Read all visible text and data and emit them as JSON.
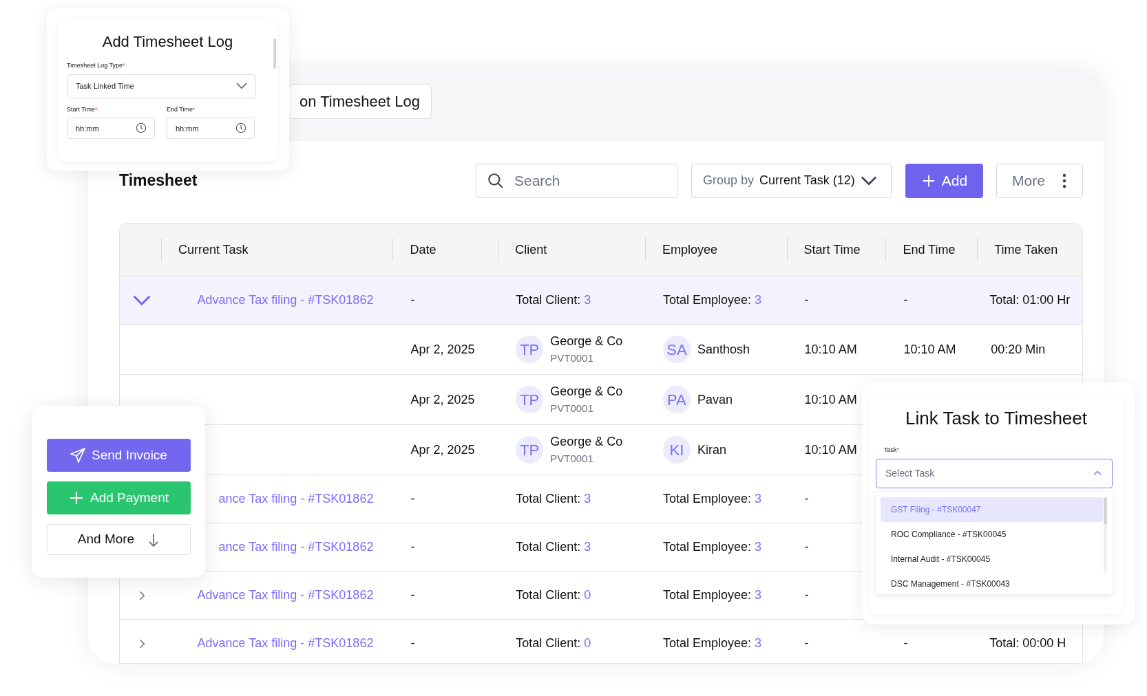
{
  "add_log_dialog": {
    "title": "Add Timesheet Log",
    "fields": [
      {
        "kind": "select",
        "label": "Timesheet Log Type",
        "mark": "*",
        "value": "Task Linked Time"
      },
      {
        "kind": "time",
        "label": "Start Time",
        "mark": "*",
        "placeholder": "hh:mm"
      },
      {
        "kind": "time",
        "label": "End Time",
        "mark": "*",
        "placeholder": "hh:mm"
      }
    ]
  },
  "main": {
    "tab": "on Timesheet Log",
    "title": "Timesheet",
    "search": {
      "placeholder": "Search"
    },
    "group_by": {
      "label": "Group by",
      "value": "Current Task (12)"
    },
    "add_button": "Add",
    "more_button": "More",
    "table": {
      "columns": [
        "Current Task",
        "Date",
        "Client",
        "Employee",
        "Start Time",
        "End Time",
        "Time Taken"
      ],
      "rows": [
        {
          "kind": "group",
          "expanded": true,
          "task": "Advance Tax filing - #TSK01862",
          "date": "-",
          "client_label": "Total Client:",
          "client_count": "3",
          "employee_label": "Total Employee:",
          "employee_count": "3",
          "start": "-",
          "end": "-",
          "time_taken": "Total: 01:00 Hr"
        },
        {
          "kind": "entry",
          "date": "Apr 2, 2025",
          "client_initials": "TP",
          "client_name": "George & Co",
          "client_code": "PVT0001",
          "employee_initials": "SA",
          "employee_name": "Santhosh",
          "start": "10:10 AM",
          "end": "10:10 AM",
          "time_taken": "00:20 Min"
        },
        {
          "kind": "entry",
          "date": "Apr 2, 2025",
          "client_initials": "TP",
          "client_name": "George & Co",
          "client_code": "PVT0001",
          "employee_initials": "PA",
          "employee_name": "Pavan",
          "start": "10:10 AM"
        },
        {
          "kind": "entry",
          "date": "Apr 2, 2025",
          "client_initials": "TP",
          "client_name": "George & Co",
          "client_code": "PVT0001",
          "employee_initials": "KI",
          "employee_name": "Kiran",
          "start": "10:10 AM"
        },
        {
          "kind": "group",
          "task": "ance Tax filing - #TSK01862",
          "date": "-",
          "client_label": "Total Client:",
          "client_count": "3",
          "employee_label": "Total Employee:",
          "employee_count": "3",
          "start": "-"
        },
        {
          "kind": "group",
          "task": "ance Tax filing - #TSK01862",
          "date": "-",
          "client_label": "Total Client:",
          "client_count": "3",
          "employee_label": "Total Employee:",
          "employee_count": "3",
          "start": "-"
        },
        {
          "kind": "group",
          "expanded": false,
          "task": "Advance Tax filing - #TSK01862",
          "date": "-",
          "client_label": "Total Client:",
          "client_count": "0",
          "employee_label": "Total Employee:",
          "employee_count": "3",
          "start": "-"
        },
        {
          "kind": "group",
          "expanded": false,
          "task": "Advance Tax filing - #TSK01862",
          "date": "-",
          "client_label": "Total Client:",
          "client_count": "0",
          "employee_label": "Total Employee:",
          "employee_count": "3",
          "start": "-",
          "end": "-",
          "time_taken": "Total: 00:00 H"
        }
      ]
    }
  },
  "actions_card": {
    "buttons": [
      {
        "kind": "send",
        "label": "Send Invoice"
      },
      {
        "kind": "payment",
        "label": "Add Payment"
      },
      {
        "kind": "more",
        "label": "And More"
      }
    ]
  },
  "link_dialog": {
    "title": "Link Task to Timesheet",
    "field": {
      "label": "Task",
      "mark": "*",
      "placeholder": "Select Task",
      "expanded": true
    },
    "options": [
      {
        "label": "GST Filing - #TSK00047",
        "selected": true
      },
      {
        "label": "ROC Compliance - #TSK00045",
        "selected": false
      },
      {
        "label": "Internal Audit - #TSK00045",
        "selected": false
      },
      {
        "label": "DSC Management - #TSK00043",
        "selected": false
      }
    ]
  }
}
